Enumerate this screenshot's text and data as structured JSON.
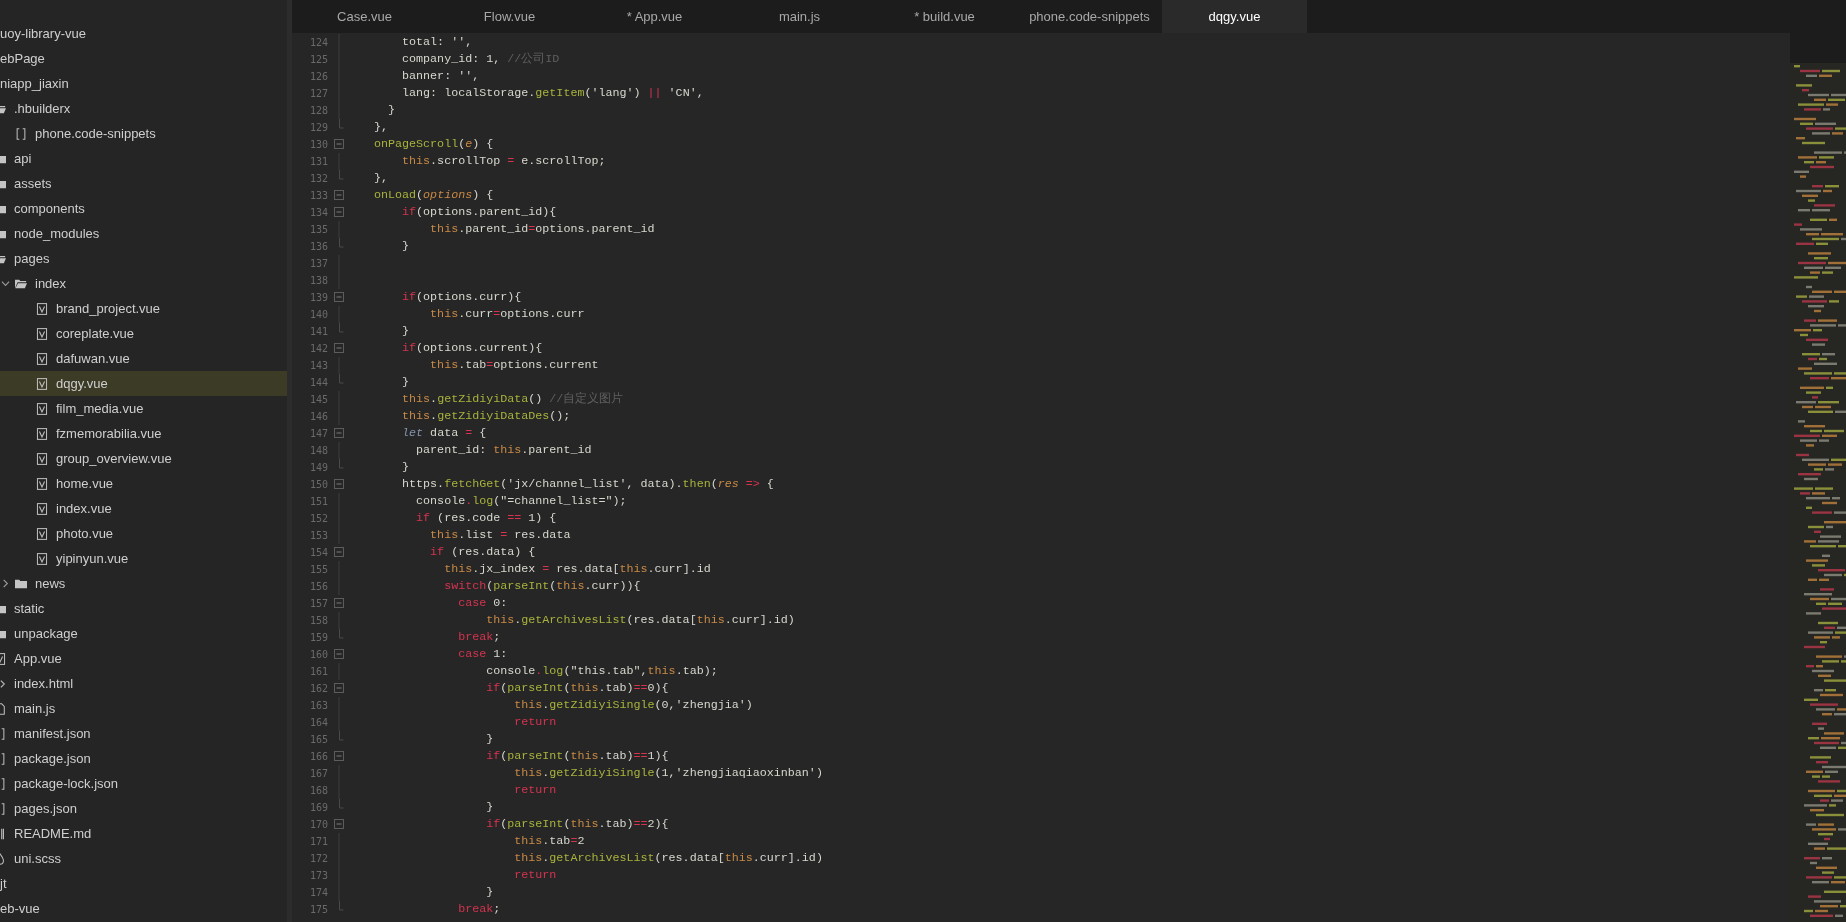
{
  "explorer": {
    "items": [
      {
        "name": "uoy-library-vue",
        "selected": false
      },
      {
        "name": "ebPage",
        "selected": false
      },
      {
        "name": "niapp_jiaxin",
        "selected": false,
        "children": [
          {
            "name": ".hbuilderx",
            "kind": "folder",
            "expanded": true,
            "selected": false,
            "children": [
              {
                "name": "phone.code-snippets",
                "kind": "snippet",
                "selected": false
              }
            ]
          },
          {
            "name": "api",
            "kind": "folder",
            "expanded": false,
            "selected": false
          },
          {
            "name": "assets",
            "kind": "folder",
            "expanded": false,
            "selected": false
          },
          {
            "name": "components",
            "kind": "folder",
            "expanded": false,
            "selected": false
          },
          {
            "name": "node_modules",
            "kind": "folder",
            "expanded": false,
            "selected": false
          },
          {
            "name": "pages",
            "kind": "folder",
            "expanded": true,
            "selected": false,
            "children": [
              {
                "name": "index",
                "kind": "folder",
                "expanded": true,
                "selected": false,
                "children": [
                  {
                    "name": "brand_project.vue",
                    "kind": "vue",
                    "selected": false
                  },
                  {
                    "name": "coreplate.vue",
                    "kind": "vue",
                    "selected": false
                  },
                  {
                    "name": "dafuwan.vue",
                    "kind": "vue",
                    "selected": false
                  },
                  {
                    "name": "dqgy.vue",
                    "kind": "vue",
                    "selected": true
                  },
                  {
                    "name": "film_media.vue",
                    "kind": "vue",
                    "selected": false
                  },
                  {
                    "name": "fzmemorabilia.vue",
                    "kind": "vue",
                    "selected": false
                  },
                  {
                    "name": "group_overview.vue",
                    "kind": "vue",
                    "selected": false
                  },
                  {
                    "name": "home.vue",
                    "kind": "vue",
                    "selected": false
                  },
                  {
                    "name": "index.vue",
                    "kind": "vue",
                    "selected": false
                  },
                  {
                    "name": "photo.vue",
                    "kind": "vue",
                    "selected": false
                  },
                  {
                    "name": "yipinyun.vue",
                    "kind": "vue",
                    "selected": false
                  }
                ]
              },
              {
                "name": "news",
                "kind": "folder",
                "expanded": false,
                "selected": false
              }
            ]
          },
          {
            "name": "static",
            "kind": "folder",
            "expanded": false,
            "selected": false
          },
          {
            "name": "unpackage",
            "kind": "folder",
            "expanded": false,
            "selected": false
          },
          {
            "name": "App.vue",
            "kind": "vue",
            "selected": false
          },
          {
            "name": "index.html",
            "kind": "html",
            "selected": false
          },
          {
            "name": "main.js",
            "kind": "js",
            "selected": false
          },
          {
            "name": "manifest.json",
            "kind": "json",
            "selected": false
          },
          {
            "name": "package.json",
            "kind": "json",
            "selected": false
          },
          {
            "name": "package-lock.json",
            "kind": "json",
            "selected": false
          },
          {
            "name": "pages.json",
            "kind": "json",
            "selected": false
          },
          {
            "name": "README.md",
            "kind": "md",
            "selected": false
          },
          {
            "name": "uni.scss",
            "kind": "scss",
            "selected": false
          }
        ]
      },
      {
        "name": "jt",
        "selected": false
      },
      {
        "name": "eb-vue",
        "selected": false
      }
    ]
  },
  "tabs": [
    {
      "label": "Case.vue",
      "selected": false
    },
    {
      "label": "Flow.vue",
      "selected": false
    },
    {
      "label": "* App.vue",
      "selected": false
    },
    {
      "label": "main.js",
      "selected": false
    },
    {
      "label": "* build.vue",
      "selected": false
    },
    {
      "label": "phone.code-snippets",
      "selected": false
    },
    {
      "label": "dqgy.vue",
      "selected": true
    }
  ],
  "editor": {
    "lines": [
      {
        "number": "124",
        "kind": "plain",
        "tokens": [
          {
            "kind": "p",
            "text": "    total: '',"
          }
        ]
      },
      {
        "number": "125",
        "kind": "plain",
        "tokens": [
          {
            "kind": "p",
            "text": "    company_id: 1, "
          },
          {
            "kind": "cm",
            "text": "//公司ID"
          }
        ]
      },
      {
        "number": "126",
        "kind": "plain",
        "tokens": [
          {
            "kind": "p",
            "text": "    banner: '',"
          }
        ]
      },
      {
        "number": "127",
        "kind": "plain",
        "tokens": [
          {
            "kind": "p",
            "text": "    lang: localStorage."
          },
          {
            "kind": "fn",
            "text": "getItem"
          },
          {
            "kind": "p",
            "text": "('lang') "
          },
          {
            "kind": "op",
            "text": "||"
          },
          {
            "kind": "p",
            "text": " 'CN',"
          }
        ]
      },
      {
        "number": "128",
        "kind": "plain",
        "tokens": [
          {
            "kind": "p",
            "text": "  }"
          }
        ]
      },
      {
        "number": "129",
        "kind": "fold_end",
        "tokens": [
          {
            "kind": "p",
            "text": "},"
          }
        ]
      },
      {
        "number": "130",
        "kind": "fold_start",
        "tokens": [
          {
            "kind": "fn",
            "text": "onPageScroll"
          },
          {
            "kind": "p",
            "text": "("
          },
          {
            "kind": "pa",
            "text": "e"
          },
          {
            "kind": "p",
            "text": ") {"
          }
        ]
      },
      {
        "number": "131",
        "kind": "plain",
        "tokens": [
          {
            "kind": "th",
            "text": "    this"
          },
          {
            "kind": "p",
            "text": ".scrollTop "
          },
          {
            "kind": "op",
            "text": "="
          },
          {
            "kind": "p",
            "text": " e.scrollTop;"
          }
        ]
      },
      {
        "number": "132",
        "kind": "fold_end",
        "tokens": [
          {
            "kind": "p",
            "text": "},"
          }
        ]
      },
      {
        "number": "133",
        "kind": "fold_start",
        "tokens": [
          {
            "kind": "fn",
            "text": "onLoad"
          },
          {
            "kind": "p",
            "text": "("
          },
          {
            "kind": "pa",
            "text": "options"
          },
          {
            "kind": "p",
            "text": ") {"
          }
        ]
      },
      {
        "number": "134",
        "kind": "fold_start",
        "tokens": [
          {
            "kind": "kw",
            "text": "    if"
          },
          {
            "kind": "p",
            "text": "(options.parent_id){"
          }
        ]
      },
      {
        "number": "135",
        "kind": "plain",
        "tokens": [
          {
            "kind": "th",
            "text": "        this"
          },
          {
            "kind": "p",
            "text": ".parent_id"
          },
          {
            "kind": "op",
            "text": "="
          },
          {
            "kind": "p",
            "text": "options.parent_id"
          }
        ]
      },
      {
        "number": "136",
        "kind": "fold_end",
        "tokens": [
          {
            "kind": "p",
            "text": "    }"
          }
        ]
      },
      {
        "number": "137",
        "kind": "plain"
      },
      {
        "number": "138",
        "kind": "plain"
      },
      {
        "number": "139",
        "kind": "fold_start",
        "tokens": [
          {
            "kind": "kw",
            "text": "    if"
          },
          {
            "kind": "p",
            "text": "(options.curr){"
          }
        ]
      },
      {
        "number": "140",
        "kind": "plain",
        "tokens": [
          {
            "kind": "th",
            "text": "        this"
          },
          {
            "kind": "p",
            "text": ".curr"
          },
          {
            "kind": "op",
            "text": "="
          },
          {
            "kind": "p",
            "text": "options.curr"
          }
        ]
      },
      {
        "number": "141",
        "kind": "fold_end",
        "tokens": [
          {
            "kind": "p",
            "text": "    }"
          }
        ]
      },
      {
        "number": "142",
        "kind": "fold_start",
        "tokens": [
          {
            "kind": "kw",
            "text": "    if"
          },
          {
            "kind": "p",
            "text": "(options.current){"
          }
        ]
      },
      {
        "number": "143",
        "kind": "plain",
        "tokens": [
          {
            "kind": "th",
            "text": "        this"
          },
          {
            "kind": "p",
            "text": ".tab"
          },
          {
            "kind": "op",
            "text": "="
          },
          {
            "kind": "p",
            "text": "options.current"
          }
        ]
      },
      {
        "number": "144",
        "kind": "fold_end",
        "tokens": [
          {
            "kind": "p",
            "text": "    }"
          }
        ]
      },
      {
        "number": "145",
        "kind": "plain",
        "tokens": [
          {
            "kind": "th",
            "text": "    this"
          },
          {
            "kind": "p",
            "text": "."
          },
          {
            "kind": "fn",
            "text": "getZidiyiData"
          },
          {
            "kind": "p",
            "text": "() "
          },
          {
            "kind": "cm",
            "text": "//自定义图片"
          }
        ]
      },
      {
        "number": "146",
        "kind": "plain",
        "tokens": [
          {
            "kind": "th",
            "text": "    this"
          },
          {
            "kind": "p",
            "text": "."
          },
          {
            "kind": "fn",
            "text": "getZidiyiDataDes"
          },
          {
            "kind": "p",
            "text": "();"
          }
        ]
      },
      {
        "number": "147",
        "kind": "fold_start",
        "tokens": [
          {
            "kind": "it",
            "text": "    let"
          },
          {
            "kind": "p",
            "text": " data "
          },
          {
            "kind": "op",
            "text": "="
          },
          {
            "kind": "p",
            "text": " {"
          }
        ]
      },
      {
        "number": "148",
        "kind": "plain",
        "tokens": [
          {
            "kind": "p",
            "text": "      parent_id: "
          },
          {
            "kind": "th",
            "text": "this"
          },
          {
            "kind": "p",
            "text": ".parent_id"
          }
        ]
      },
      {
        "number": "149",
        "kind": "fold_end",
        "tokens": [
          {
            "kind": "p",
            "text": "    }"
          }
        ]
      },
      {
        "number": "150",
        "kind": "fold_start",
        "tokens": [
          {
            "kind": "p",
            "text": "    https."
          },
          {
            "kind": "fn",
            "text": "fetchGet"
          },
          {
            "kind": "p",
            "text": "('jx/channel_list', data)."
          },
          {
            "kind": "fn",
            "text": "then"
          },
          {
            "kind": "p",
            "text": "("
          },
          {
            "kind": "pa",
            "text": "res"
          },
          {
            "kind": "op",
            "text": " =>"
          },
          {
            "kind": "p",
            "text": " {"
          }
        ]
      },
      {
        "number": "151",
        "kind": "plain",
        "tokens": [
          {
            "kind": "p",
            "text": "      console"
          },
          {
            "kind": "op",
            "text": "."
          },
          {
            "kind": "fn",
            "text": "log"
          },
          {
            "kind": "p",
            "text": "(\"=channel_list=\");"
          }
        ]
      },
      {
        "number": "152",
        "kind": "plain",
        "tokens": [
          {
            "kind": "kw",
            "text": "      if"
          },
          {
            "kind": "p",
            "text": " (res.code "
          },
          {
            "kind": "op",
            "text": "=="
          },
          {
            "kind": "p",
            "text": " 1) {"
          }
        ]
      },
      {
        "number": "153",
        "kind": "plain",
        "tokens": [
          {
            "kind": "th",
            "text": "        this"
          },
          {
            "kind": "p",
            "text": ".list "
          },
          {
            "kind": "op",
            "text": "="
          },
          {
            "kind": "p",
            "text": " res.data"
          }
        ]
      },
      {
        "number": "154",
        "kind": "fold_start",
        "tokens": [
          {
            "kind": "kw",
            "text": "        if"
          },
          {
            "kind": "p",
            "text": " (res.data) {"
          }
        ]
      },
      {
        "number": "155",
        "kind": "plain",
        "tokens": [
          {
            "kind": "th",
            "text": "          this"
          },
          {
            "kind": "p",
            "text": ".jx_index "
          },
          {
            "kind": "op",
            "text": "="
          },
          {
            "kind": "p",
            "text": " res.data["
          },
          {
            "kind": "th",
            "text": "this"
          },
          {
            "kind": "p",
            "text": ".curr].id"
          }
        ]
      },
      {
        "number": "156",
        "kind": "plain",
        "tokens": [
          {
            "kind": "kw",
            "text": "          switch"
          },
          {
            "kind": "p",
            "text": "("
          },
          {
            "kind": "fn",
            "text": "parseInt"
          },
          {
            "kind": "p",
            "text": "("
          },
          {
            "kind": "th",
            "text": "this"
          },
          {
            "kind": "p",
            "text": ".curr)){"
          }
        ]
      },
      {
        "number": "157",
        "kind": "fold_start",
        "tokens": [
          {
            "kind": "kw",
            "text": "            case"
          },
          {
            "kind": "p",
            "text": " 0:"
          }
        ]
      },
      {
        "number": "158",
        "kind": "plain",
        "tokens": [
          {
            "kind": "th",
            "text": "                this"
          },
          {
            "kind": "p",
            "text": "."
          },
          {
            "kind": "fn",
            "text": "getArchivesList"
          },
          {
            "kind": "p",
            "text": "(res.data["
          },
          {
            "kind": "th",
            "text": "this"
          },
          {
            "kind": "p",
            "text": ".curr].id)"
          }
        ]
      },
      {
        "number": "159",
        "kind": "fold_end",
        "tokens": [
          {
            "kind": "kw",
            "text": "            break"
          },
          {
            "kind": "p",
            "text": ";"
          }
        ]
      },
      {
        "number": "160",
        "kind": "fold_start",
        "tokens": [
          {
            "kind": "kw",
            "text": "            case"
          },
          {
            "kind": "p",
            "text": " 1:"
          }
        ]
      },
      {
        "number": "161",
        "kind": "plain",
        "tokens": [
          {
            "kind": "p",
            "text": "                console"
          },
          {
            "kind": "op",
            "text": "."
          },
          {
            "kind": "fn",
            "text": "log"
          },
          {
            "kind": "p",
            "text": "(\"this.tab\","
          },
          {
            "kind": "th",
            "text": "this"
          },
          {
            "kind": "p",
            "text": ".tab);"
          }
        ]
      },
      {
        "number": "162",
        "kind": "fold_start",
        "tokens": [
          {
            "kind": "kw",
            "text": "                if"
          },
          {
            "kind": "p",
            "text": "("
          },
          {
            "kind": "fn",
            "text": "parseInt"
          },
          {
            "kind": "p",
            "text": "("
          },
          {
            "kind": "th",
            "text": "this"
          },
          {
            "kind": "p",
            "text": ".tab)"
          },
          {
            "kind": "op",
            "text": "=="
          },
          {
            "kind": "p",
            "text": "0){"
          }
        ]
      },
      {
        "number": "163",
        "kind": "plain",
        "tokens": [
          {
            "kind": "th",
            "text": "                    this"
          },
          {
            "kind": "p",
            "text": "."
          },
          {
            "kind": "fn",
            "text": "getZidiyiSingle"
          },
          {
            "kind": "p",
            "text": "(0,'zhengjia')"
          }
        ]
      },
      {
        "number": "164",
        "kind": "plain",
        "tokens": [
          {
            "kind": "kw",
            "text": "                    return"
          }
        ]
      },
      {
        "number": "165",
        "kind": "fold_end",
        "tokens": [
          {
            "kind": "p",
            "text": "                }"
          }
        ]
      },
      {
        "number": "166",
        "kind": "fold_start",
        "tokens": [
          {
            "kind": "kw",
            "text": "                if"
          },
          {
            "kind": "p",
            "text": "("
          },
          {
            "kind": "fn",
            "text": "parseInt"
          },
          {
            "kind": "p",
            "text": "("
          },
          {
            "kind": "th",
            "text": "this"
          },
          {
            "kind": "p",
            "text": ".tab)"
          },
          {
            "kind": "op",
            "text": "=="
          },
          {
            "kind": "p",
            "text": "1){"
          }
        ]
      },
      {
        "number": "167",
        "kind": "plain",
        "tokens": [
          {
            "kind": "th",
            "text": "                    this"
          },
          {
            "kind": "p",
            "text": "."
          },
          {
            "kind": "fn",
            "text": "getZidiyiSingle"
          },
          {
            "kind": "p",
            "text": "(1,'zhengjiaqiaoxinban')"
          }
        ]
      },
      {
        "number": "168",
        "kind": "plain",
        "tokens": [
          {
            "kind": "kw",
            "text": "                    return"
          }
        ]
      },
      {
        "number": "169",
        "kind": "fold_end",
        "tokens": [
          {
            "kind": "p",
            "text": "                }"
          }
        ]
      },
      {
        "number": "170",
        "kind": "fold_start",
        "tokens": [
          {
            "kind": "kw",
            "text": "                if"
          },
          {
            "kind": "p",
            "text": "("
          },
          {
            "kind": "fn",
            "text": "parseInt"
          },
          {
            "kind": "p",
            "text": "("
          },
          {
            "kind": "th",
            "text": "this"
          },
          {
            "kind": "p",
            "text": ".tab)"
          },
          {
            "kind": "op",
            "text": "=="
          },
          {
            "kind": "p",
            "text": "2){"
          }
        ]
      },
      {
        "number": "171",
        "kind": "plain",
        "tokens": [
          {
            "kind": "th",
            "text": "                    this"
          },
          {
            "kind": "p",
            "text": ".tab"
          },
          {
            "kind": "op",
            "text": "="
          },
          {
            "kind": "p",
            "text": "2"
          }
        ]
      },
      {
        "number": "172",
        "kind": "plain",
        "tokens": [
          {
            "kind": "th",
            "text": "                    this"
          },
          {
            "kind": "p",
            "text": "."
          },
          {
            "kind": "fn",
            "text": "getArchivesList"
          },
          {
            "kind": "p",
            "text": "(res.data["
          },
          {
            "kind": "th",
            "text": "this"
          },
          {
            "kind": "p",
            "text": ".curr].id)"
          }
        ]
      },
      {
        "number": "173",
        "kind": "plain",
        "tokens": [
          {
            "kind": "kw",
            "text": "                    return"
          }
        ]
      },
      {
        "number": "174",
        "kind": "plain",
        "tokens": [
          {
            "kind": "p",
            "text": "                }"
          }
        ]
      },
      {
        "number": "175",
        "kind": "fold_end",
        "tokens": [
          {
            "kind": "kw",
            "text": "            break"
          },
          {
            "kind": "p",
            "text": ";"
          }
        ]
      }
    ]
  }
}
